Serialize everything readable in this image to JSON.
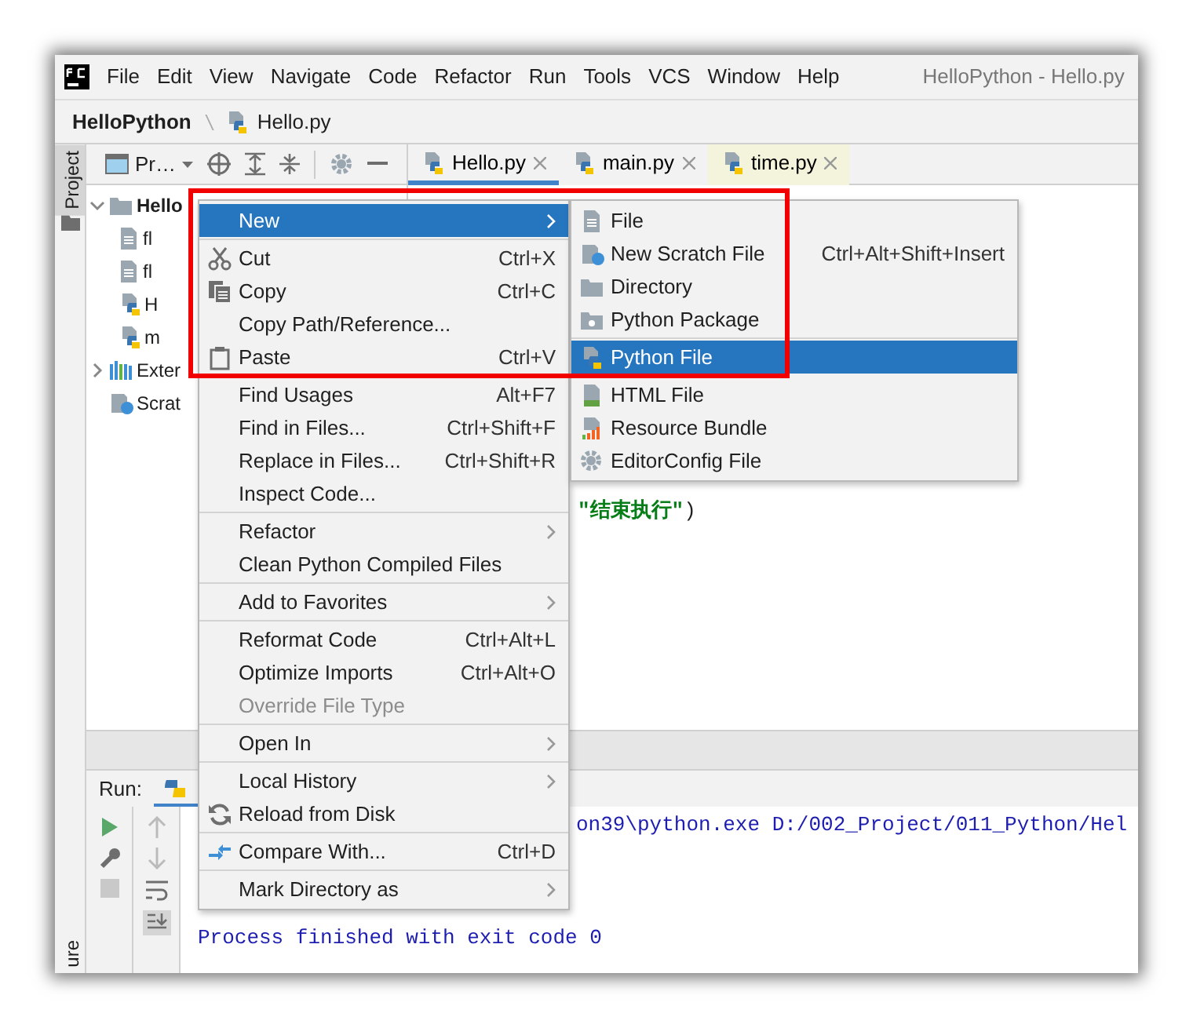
{
  "window": {
    "title": "HelloPython - Hello.py"
  },
  "menu_bar": [
    "File",
    "Edit",
    "View",
    "Navigate",
    "Code",
    "Refactor",
    "Run",
    "Tools",
    "VCS",
    "Window",
    "Help"
  ],
  "breadcrumb": [
    {
      "label": "HelloPython"
    },
    {
      "label": "Hello.py"
    }
  ],
  "side_tabs": [
    {
      "label": "Project",
      "selected": true
    },
    {
      "label": "ure",
      "selected": false
    }
  ],
  "project_toolbar": {
    "label": "Pr…"
  },
  "editor_tabs": [
    {
      "label": "Hello.py",
      "selected": true,
      "color": "#f2f2f2"
    },
    {
      "label": "main.py",
      "selected": false,
      "color": "#f2f2f2"
    },
    {
      "label": "time.py",
      "selected": false,
      "color": "#f4f4dc"
    }
  ],
  "project_tree": [
    {
      "label": "Hello",
      "kind": "folder",
      "expanded": true,
      "children": [
        {
          "label": "fl",
          "kind": "text"
        },
        {
          "label": "fl",
          "kind": "text"
        },
        {
          "label": "H",
          "kind": "python"
        },
        {
          "label": "m",
          "kind": "python"
        }
      ]
    },
    {
      "label": "Exter",
      "kind": "library",
      "expanded": false
    },
    {
      "label": "Scrat",
      "kind": "scratch"
    }
  ],
  "editor": {
    "lines": [
      {
        "string": "\"结束执行\"",
        "rest": ")"
      }
    ]
  },
  "context_menu": {
    "items": [
      {
        "kind": "plain",
        "label": "New",
        "submenu": true,
        "selected": true,
        "disabled": false
      },
      {
        "kind": "separator"
      },
      {
        "kind": "cut",
        "label": "Cut",
        "shortcut": "Ctrl+X",
        "selected": false,
        "disabled": false
      },
      {
        "kind": "copy",
        "label": "Copy",
        "shortcut": "Ctrl+C",
        "selected": false,
        "disabled": false
      },
      {
        "kind": "plain",
        "label": "Copy Path/Reference...",
        "selected": false,
        "disabled": false
      },
      {
        "kind": "paste",
        "label": "Paste",
        "shortcut": "Ctrl+V",
        "selected": false,
        "disabled": false
      },
      {
        "kind": "separator"
      },
      {
        "kind": "plain",
        "label": "Find Usages",
        "shortcut": "Alt+F7",
        "selected": false,
        "disabled": false
      },
      {
        "kind": "plain",
        "label": "Find in Files...",
        "shortcut": "Ctrl+Shift+F",
        "selected": false,
        "disabled": false
      },
      {
        "kind": "plain",
        "label": "Replace in Files...",
        "shortcut": "Ctrl+Shift+R",
        "selected": false,
        "disabled": false
      },
      {
        "kind": "plain",
        "label": "Inspect Code...",
        "selected": false,
        "disabled": false
      },
      {
        "kind": "separator"
      },
      {
        "kind": "plain",
        "label": "Refactor",
        "submenu": true,
        "selected": false,
        "disabled": false
      },
      {
        "kind": "plain",
        "label": "Clean Python Compiled Files",
        "selected": false,
        "disabled": false
      },
      {
        "kind": "separator"
      },
      {
        "kind": "plain",
        "label": "Add to Favorites",
        "submenu": true,
        "selected": false,
        "disabled": false
      },
      {
        "kind": "separator"
      },
      {
        "kind": "plain",
        "label": "Reformat Code",
        "shortcut": "Ctrl+Alt+L",
        "selected": false,
        "disabled": false
      },
      {
        "kind": "plain",
        "label": "Optimize Imports",
        "shortcut": "Ctrl+Alt+O",
        "selected": false,
        "disabled": false
      },
      {
        "kind": "plain",
        "label": "Override File Type",
        "selected": false,
        "disabled": true
      },
      {
        "kind": "separator"
      },
      {
        "kind": "plain",
        "label": "Open In",
        "submenu": true,
        "selected": false,
        "disabled": false
      },
      {
        "kind": "separator"
      },
      {
        "kind": "plain",
        "label": "Local History",
        "submenu": true,
        "selected": false,
        "disabled": false
      },
      {
        "kind": "reload",
        "label": "Reload from Disk",
        "selected": false,
        "disabled": false
      },
      {
        "kind": "separator"
      },
      {
        "kind": "compare",
        "label": "Compare With...",
        "shortcut": "Ctrl+D",
        "selected": false,
        "disabled": false
      },
      {
        "kind": "separator"
      },
      {
        "kind": "plain",
        "label": "Mark Directory as",
        "submenu": true,
        "selected": false,
        "disabled": false
      }
    ]
  },
  "submenu": {
    "items": [
      {
        "kind": "file",
        "label": "File",
        "selected": false
      },
      {
        "kind": "scratch",
        "label": "New Scratch File",
        "shortcut": "Ctrl+Alt+Shift+Insert",
        "selected": false
      },
      {
        "kind": "folder",
        "label": "Directory",
        "selected": false
      },
      {
        "kind": "package",
        "label": "Python Package",
        "selected": false
      },
      {
        "kind": "separator"
      },
      {
        "kind": "python",
        "label": "Python File",
        "selected": true
      },
      {
        "kind": "html",
        "label": "HTML File",
        "selected": false
      },
      {
        "kind": "bundle",
        "label": "Resource Bundle",
        "selected": false
      },
      {
        "kind": "gear",
        "label": "EditorConfig File",
        "selected": false
      }
    ]
  },
  "run_panel": {
    "label": "Run:",
    "output": [
      {
        "text": "on39\\python.exe D:/002_Project/011_Python/Hel",
        "kind": "path"
      },
      {
        "text": "Process finished with exit code 0",
        "kind": "status"
      }
    ]
  }
}
